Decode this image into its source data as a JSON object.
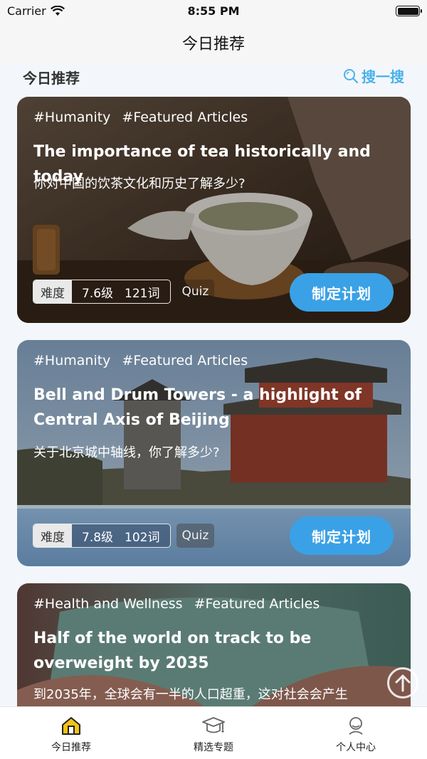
{
  "status_bar": {
    "carrier": "Carrier",
    "time": "8:55 PM"
  },
  "nav": {
    "title": "今日推荐"
  },
  "section": {
    "title": "今日推荐",
    "search_label": "搜一搜"
  },
  "colors": {
    "accent": "#3aa1e6",
    "link": "#49b2ea",
    "tab_active": "#f3c316"
  },
  "cards": [
    {
      "tags": [
        "#Humanity",
        "#Featured Articles"
      ],
      "title": "The importance of tea historically and today",
      "subtitle": "你对中国的饮茶文化和历史了解多少?",
      "difficulty_label": "难度",
      "level": "7.6级",
      "words": "121词",
      "quiz": "Quiz",
      "plan_button": "制定计划"
    },
    {
      "tags": [
        "#Humanity",
        "#Featured Articles"
      ],
      "title": "Bell and Drum Towers - a highlight of Central Axis of Beijing",
      "subtitle": "关于北京城中轴线，你了解多少?",
      "difficulty_label": "难度",
      "level": "7.8级",
      "words": "102词",
      "quiz": "Quiz",
      "plan_button": "制定计划"
    },
    {
      "tags": [
        "#Health and Wellness",
        "#Featured Articles"
      ],
      "title": "Half of the world on track to be overweight by 2035",
      "subtitle": "到2035年，全球会有一半的人口超重，这对社会会产生"
    }
  ],
  "tabs": [
    {
      "label": "今日推荐",
      "icon": "home-icon"
    },
    {
      "label": "精选专题",
      "icon": "graduation-cap-icon"
    },
    {
      "label": "个人中心",
      "icon": "user-icon"
    }
  ]
}
